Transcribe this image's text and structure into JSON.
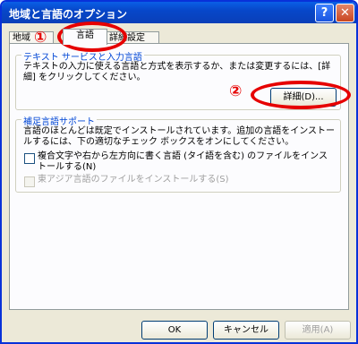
{
  "window": {
    "title": "地域と言語のオプション"
  },
  "titlebar": {
    "help_label": "?",
    "close_label": "✕"
  },
  "tabs": [
    {
      "label": "地域"
    },
    {
      "label": "言語"
    },
    {
      "label": "詳細設定"
    }
  ],
  "text_services": {
    "group_title": "テキスト サービスと入力言語",
    "description": "テキストの入力に使える言語と方式を表示するか、または変更するには、[詳細] をクリックしてください。",
    "details_button": "詳細(D)..."
  },
  "supplemental": {
    "group_title": "補足言語サポート",
    "description": "言語のほとんどは既定でインストールされています。追加の言語をインストールするには、下の適切なチェック ボックスをオンにしてください。",
    "checkbox1_label": "複合文字や右から左方向に書く言語 (タイ語を含む) のファイルをインストールする(N)",
    "checkbox2_label": "東アジア言語のファイルをインストールする(S)"
  },
  "annotations": {
    "mark1": "①",
    "mark2": "②"
  },
  "footer": {
    "ok": "OK",
    "cancel": "キャンセル",
    "apply": "適用(A)"
  }
}
